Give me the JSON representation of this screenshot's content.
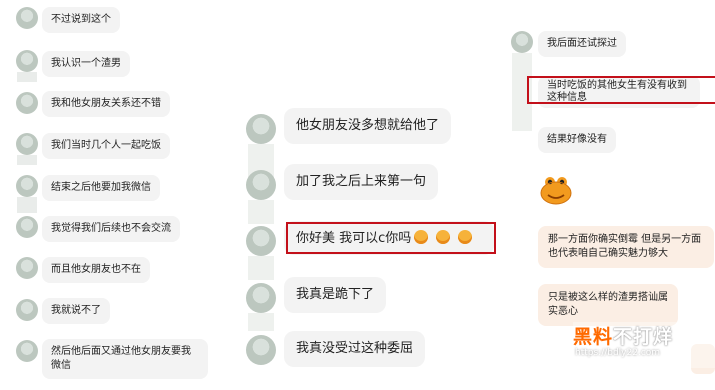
{
  "left": {
    "messages": [
      "不过说到这个",
      "我认识一个渣男",
      "我和他女朋友关系还不错",
      "我们当时几个人一起吃饭",
      "结束之后他要加我微信",
      "我觉得我们后续也不会交流",
      "而且他女朋友也不在",
      "我就说不了",
      "然后他后面又通过他女朋友要我微信"
    ]
  },
  "middle": {
    "messages": [
      "他女朋友没多想就给他了",
      "加了我之后上来第一句",
      "你好美 我可以c你吗",
      "我真是跪下了",
      "我真没受过这种委屈"
    ]
  },
  "right": {
    "messages": [
      "我后面还试探过",
      "当时吃饭的其他女生有没有收到这种信息",
      "结果好像没有",
      "那一方面你确实倒霉 但是另一方面也代表咱自己确实魅力够大",
      "只是被这么样的渣男搭讪属实恶心"
    ]
  },
  "watermark": {
    "brand_part1": "黑料",
    "brand_part2": "不打烊",
    "url": "https://bdly22.com"
  },
  "colors": {
    "highlight": "#c3101a",
    "bubble": "#f3f3f3",
    "reply_bubble": "#fbeee4",
    "emoji": "#f6b23a"
  }
}
